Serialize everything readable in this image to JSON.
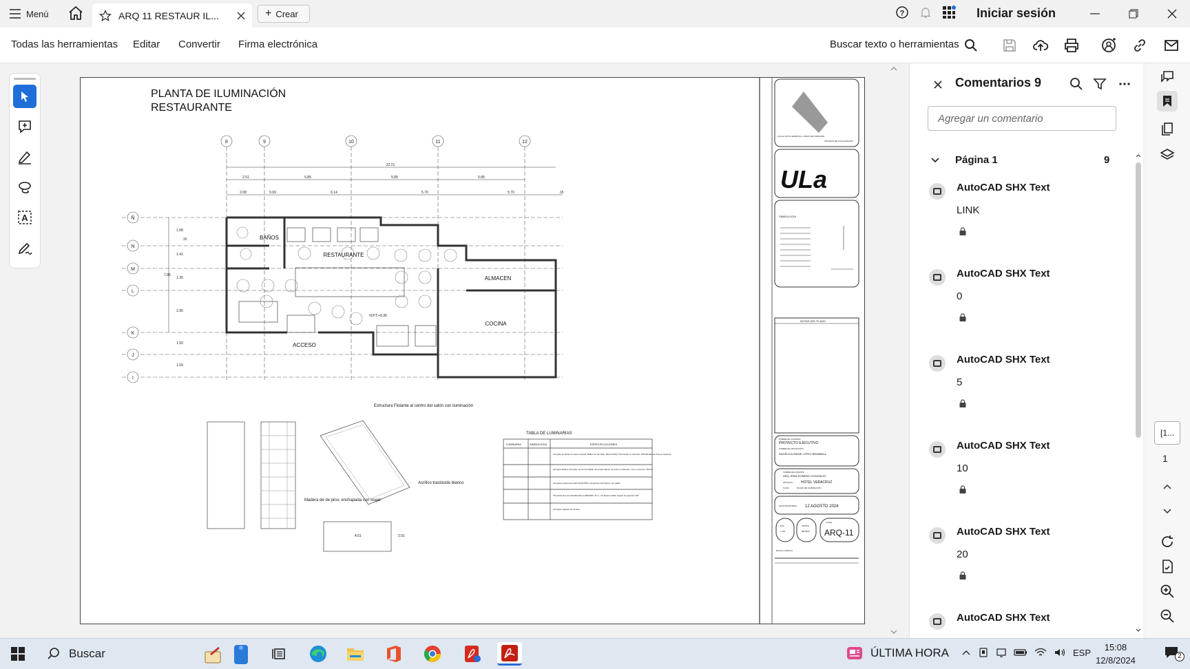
{
  "titlebar": {
    "menu_label": "Menú",
    "tab_label": "ARQ 11 RESTAUR IL...",
    "create_label": "Crear",
    "signin_label": "Iniciar sesión"
  },
  "toolbar": {
    "menus": [
      "Todas las herramientas",
      "Editar",
      "Convertir",
      "Firma electrónica"
    ],
    "search_label": "Buscar texto o herramientas"
  },
  "drawing": {
    "title_line1": "PLANTA DE ILUMINACIÓN",
    "title_line2": "RESTAURANTE",
    "axis_cols": [
      "8",
      "9",
      "10",
      "11",
      "12"
    ],
    "axis_rows": [
      "Ñ",
      "N",
      "M",
      "L",
      "K",
      "J",
      "I"
    ],
    "dims_total": "22.21",
    "dims_row1": [
      "2.51",
      "5.85",
      "5.85",
      "5.85"
    ],
    "dims_row2": [
      "2.08",
      "5.69",
      "6.14",
      "5.70",
      "5.70",
      ".15"
    ],
    "dims_left": [
      "1.58",
      ".15",
      "1.41",
      "1.35",
      "2.95",
      "1.50",
      "1.50"
    ],
    "dim_left_total": "7.85",
    "rooms": {
      "banos": "BAÑOS",
      "restaurante": "RESTAURANTE",
      "almacen": "ALMACEN",
      "cocina": "COCINA",
      "acceso": "ACCESO",
      "npt": "N.P.T.+0.30"
    },
    "detail_label_1": "Estructura Flotante  al centro del salón  con iluminación",
    "detail_label_2": "Madera de de pino, enchapada con nogal",
    "detail_label_3": "Acrílico traslúcido blanco",
    "detail_dim_1": "4.51",
    "detail_dim_2": "2.01",
    "table_title": "TABLA DE LUMINARIAS",
    "table_headers": [
      "LUMINARIA",
      "SIMBOLOGÍA",
      "ESPECIFICACIONES"
    ],
    "table_rows": [
      "Lámpara de doble luz para empotrar, Bafles de Tecnolite, Marca W2Q.3 Terminado en aluminio. MTD4W4AL de 8 W por lámpara",
      "Lámpara Albania Tecnolite, de luz led cálida, terminado blanco, de 110 mm diámetro, 13 w, Lúmenes: 900 lm",
      "Lámpara moderna de LED AC90-265V. Lamparita color blanco, luz cálida",
      "Tira plana de Led autoadherible  ILUMILEDS, 11 w , luz blanca cálida, ángulo de apertura 120°",
      "Lámpara colgante de mimbre"
    ],
    "cartouche": {
      "location_caption": "CALLE VISTA HERMOSA, LOMAS DEL MIRADOR",
      "location_sub": "CROQUIS DE LOCALIZACIÓN",
      "logo_text": "ULa",
      "simbologia": "SIMBOLOGÍA",
      "notas": "NOTAS DEL PLANO",
      "nombre_materia_label": "NOMBRE DE LA MATERIA",
      "proyecto": "PROYECTO EJECUTIVO",
      "nombre_proyectista_label": "NOMBRE DEL PROYECTISTA",
      "proyectista": "ANGÉLICA IRENE LÓPEZ BRAMBILA",
      "nombre_docente_label": "NOMBRE DEL DOCENTE",
      "docente": "ARQ. IRMA ROMERO GONZÁLEZ",
      "proyecto_label": "PROYECTO",
      "hotel": "HOTEL VERACRUZ",
      "plano_label": "PLANO",
      "plano": "PLANO DE ILUMINACIÓN",
      "fecha_label": "FECHA DE ENTREGA",
      "fecha": "12 AGOSTO 2024",
      "esc_label": "ESC",
      "esc_value": "1:100",
      "unidad_label": "UNIDAD",
      "unidad_value": "METROS",
      "clave_label": "CLAVE",
      "clave": "ARQ-11",
      "escala_grafica": "ESCALA GRÁFICA"
    }
  },
  "comments": {
    "title": "Comentarios 9",
    "placeholder": "Agregar un comentario",
    "page_label": "Página 1",
    "page_count": "9",
    "items": [
      {
        "author": "AutoCAD SHX Text",
        "text": "LINK"
      },
      {
        "author": "AutoCAD SHX Text",
        "text": "0"
      },
      {
        "author": "AutoCAD SHX Text",
        "text": "5"
      },
      {
        "author": "AutoCAD SHX Text",
        "text": "10"
      },
      {
        "author": "AutoCAD SHX Text",
        "text": "20"
      },
      {
        "author": "AutoCAD SHX Text",
        "text": ""
      }
    ]
  },
  "rightrail": {
    "page_box": "[1...",
    "page_num": "1"
  },
  "taskbar": {
    "search_label": "Buscar",
    "news_label": "ÚLTIMA HORA",
    "lang": "ESP",
    "time": "15:08",
    "date": "12/8/2024",
    "notif_count": "2"
  }
}
